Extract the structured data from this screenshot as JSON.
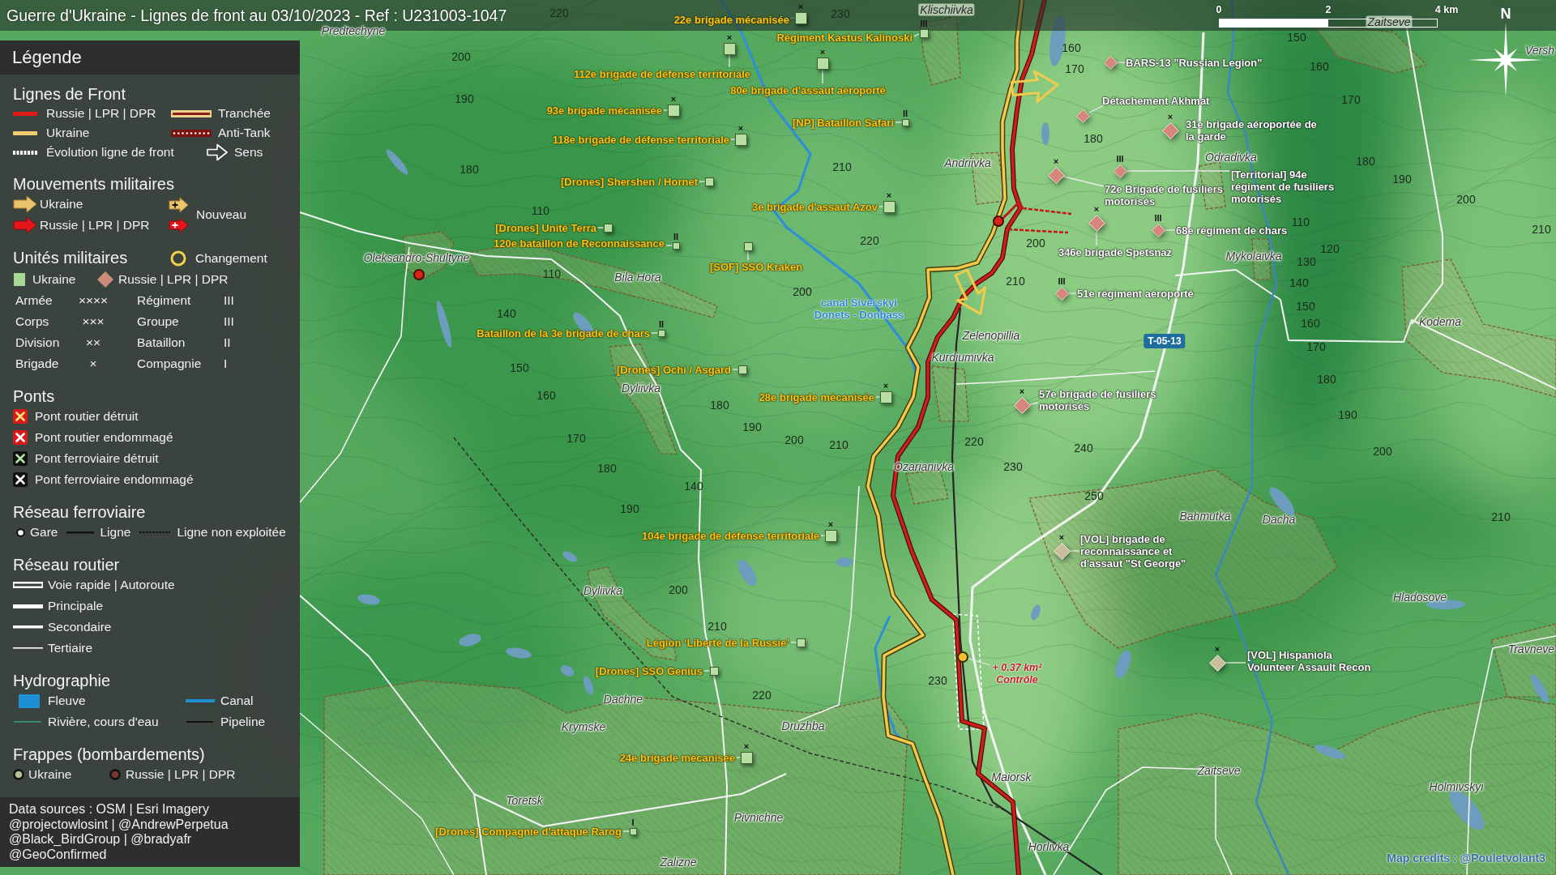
{
  "title_bar": {
    "title": "Guerre d'Ukraine - Lignes de front au 03/10/2023 - Ref : U231003-1047"
  },
  "scale_bar": {
    "ticks": [
      "0",
      "2",
      "4 km"
    ]
  },
  "compass": {
    "label": "N"
  },
  "legend": {
    "title": "Légende",
    "sections": [
      {
        "kind": "front-lines",
        "title": "Lignes de Front",
        "items": [
          {
            "kind": "russia-line",
            "label": "Russie | LPR | DPR"
          },
          {
            "kind": "trench",
            "label": "Tranchée"
          },
          {
            "kind": "ukraine-line",
            "label": "Ukraine"
          },
          {
            "kind": "anti-tank",
            "label": "Anti-Tank"
          },
          {
            "kind": "evolution",
            "label": "Évolution ligne de front"
          },
          {
            "kind": "direction",
            "label": "Sens"
          }
        ]
      },
      {
        "kind": "movements",
        "title": "Mouvements militaires",
        "items": [
          {
            "kind": "ukraine-arrow",
            "label": "Ukraine"
          },
          {
            "kind": "new-arrows",
            "label": "Nouveau"
          },
          {
            "kind": "russia-arrow",
            "label": "Russie | LPR | DPR"
          }
        ]
      },
      {
        "kind": "units",
        "title": "Unités militaires",
        "aside": {
          "kind": "change-ring",
          "label": "Changement"
        },
        "items": [
          {
            "kind": "ukraine-unit",
            "label": "Ukraine"
          },
          {
            "kind": "russia-unit",
            "label": "Russie | LPR | DPR"
          }
        ],
        "echelons": [
          {
            "label": "Armée",
            "symbol": "××××"
          },
          {
            "label": "Régiment",
            "symbol": "III"
          },
          {
            "label": "Corps",
            "symbol": "×××"
          },
          {
            "label": "Groupe",
            "symbol": "III"
          },
          {
            "label": "Division",
            "symbol": "××"
          },
          {
            "label": "Bataillon",
            "symbol": "II"
          },
          {
            "label": "Brigade",
            "symbol": "×"
          },
          {
            "label": "Compagnie",
            "symbol": "I"
          }
        ]
      },
      {
        "kind": "bridges",
        "title": "Ponts",
        "items": [
          {
            "kind": "road-destroyed",
            "label": "Pont routier détruit"
          },
          {
            "kind": "road-damaged",
            "label": "Pont routier endommagé"
          },
          {
            "kind": "rail-destroyed",
            "label": "Pont ferroviaire détruit"
          },
          {
            "kind": "rail-damaged",
            "label": "Pont ferroviaire endommagé"
          }
        ]
      },
      {
        "kind": "railway",
        "title": "Réseau ferroviaire",
        "items": [
          {
            "kind": "station",
            "label": "Gare"
          },
          {
            "kind": "rail-line",
            "label": "Ligne"
          },
          {
            "kind": "rail-disused",
            "label": "Ligne non exploitée"
          }
        ]
      },
      {
        "kind": "roads",
        "title": "Réseau routier",
        "items": [
          {
            "kind": "expressway",
            "label": "Voie rapide | Autoroute"
          },
          {
            "kind": "primary",
            "label": "Principale"
          },
          {
            "kind": "secondary",
            "label": "Secondaire"
          },
          {
            "kind": "tertiary",
            "label": "Tertiaire"
          }
        ]
      },
      {
        "kind": "hydro",
        "title": "Hydrographie",
        "items": [
          {
            "kind": "river-area",
            "label": "Fleuve"
          },
          {
            "kind": "canal",
            "label": "Canal"
          },
          {
            "kind": "stream",
            "label": "Rivière, cours d'eau"
          },
          {
            "kind": "pipeline",
            "label": "Pipeline"
          }
        ]
      },
      {
        "kind": "strikes",
        "title": "Frappes (bombardements)",
        "items": [
          {
            "kind": "ukraine-strike",
            "label": "Ukraine"
          },
          {
            "kind": "russia-strike",
            "label": "Russie | LPR | DPR"
          }
        ]
      }
    ],
    "sources": [
      "Data sources : OSM | Esri Imagery",
      "@projectowlosint | @AndrewPerpetua",
      "@Black_BirdGroup | @bradyafr",
      "@GeoConfirmed"
    ]
  },
  "map": {
    "places": [
      "Predtechyne",
      "Klischiivka",
      "Zaitseve",
      "Versh",
      "Andriivka",
      "Odradivka",
      "Oleksandro-Shultyne",
      "Mykolaivka",
      "Bila Hora",
      "Kodema",
      "Zelenopillia",
      "Kurdiumivka",
      "Dyliivka",
      "Ozarianivka",
      "Bahmutka",
      "Dacha",
      "Dyliivka",
      "Hladosove",
      "Travneve",
      "Dachne",
      "Druzhba",
      "Krymske",
      "Zaitseve",
      "Maiorsk",
      "Holmivskyi",
      "Toretsk",
      "Pivnichne",
      "Horlivka",
      "Zalizne"
    ],
    "elevations": [
      "220",
      "230",
      "150",
      "160",
      "200",
      "160",
      "170",
      "190",
      "170",
      "180",
      "180",
      "210",
      "180",
      "190",
      "200",
      "110",
      "110",
      "210",
      "220",
      "200",
      "120",
      "130",
      "110",
      "210",
      "140",
      "200",
      "150",
      "140",
      "160",
      "170",
      "150",
      "180",
      "160",
      "180",
      "190",
      "190",
      "170",
      "200",
      "220",
      "210",
      "240",
      "200",
      "230",
      "180",
      "140",
      "250",
      "190",
      "210",
      "200",
      "210",
      "230",
      "220"
    ],
    "canal_label": "canal Siverskyi Donets - Donbass",
    "road_number": "T-05-13",
    "units": [
      {
        "name": "22e brigade mécanisée",
        "echelon": "×",
        "kind": "ukraine"
      },
      {
        "name": "Régiment Kastus Kalinoski",
        "echelon": "III",
        "kind": "ukraine"
      },
      {
        "name": "112e brigade de défense territoriale",
        "echelon": "×",
        "kind": "ukraine"
      },
      {
        "name": "80e brigade d'assaut aéroporté",
        "echelon": "×",
        "kind": "ukraine"
      },
      {
        "name": "93e brigade mécanisée",
        "echelon": "×",
        "kind": "ukraine"
      },
      {
        "name": "[NP] Bataillon Safari",
        "echelon": "II",
        "kind": "ukraine"
      },
      {
        "name": "118e brigade de défense territoriale",
        "echelon": "×",
        "kind": "ukraine"
      },
      {
        "name": "[Drones] Shershen / Hornet",
        "kind": "ukraine"
      },
      {
        "name": "3e brigade d'assaut Azov",
        "echelon": "×",
        "kind": "ukraine"
      },
      {
        "name": "[Drones] Unité Terra",
        "kind": "ukraine"
      },
      {
        "name": "120e bataillon de Reconnaissance",
        "echelon": "II",
        "kind": "ukraine"
      },
      {
        "name": "[SOF] SSO Kraken",
        "kind": "ukraine"
      },
      {
        "name": "Bataillon de la 3e brigade de chars",
        "echelon": "II",
        "kind": "ukraine"
      },
      {
        "name": "[Drones] Ochi / Asgard",
        "kind": "ukraine"
      },
      {
        "name": "28e brigade mécanisée",
        "echelon": "×",
        "kind": "ukraine"
      },
      {
        "name": "104e brigade de défense territoriale",
        "echelon": "×",
        "kind": "ukraine"
      },
      {
        "name": "Légion ‘Liberté de la Russie’",
        "kind": "ukraine"
      },
      {
        "name": "[Drones] SSO Genius",
        "kind": "ukraine"
      },
      {
        "name": "24e brigade mécanisée",
        "echelon": "×",
        "kind": "ukraine"
      },
      {
        "name": "[Drones] Compagnie d'attaque Rarog",
        "echelon": "I",
        "kind": "ukraine"
      },
      {
        "name": "BARS-13 \"Russian Legion\"",
        "kind": "russia"
      },
      {
        "name": "Détachement Akhmat",
        "kind": "russia"
      },
      {
        "name": "31e brigade aéroportée de la garde",
        "echelon": "×",
        "kind": "russia"
      },
      {
        "name": "72e Brigade de fusiliers motorisés",
        "echelon": "×",
        "kind": "russia"
      },
      {
        "name": "[Territorial] 94e régiment de fusiliers motorisés",
        "echelon": "III",
        "kind": "russia"
      },
      {
        "name": "346e brigade Spetsnaz",
        "echelon": "×",
        "kind": "russia"
      },
      {
        "name": "68e régiment de chars",
        "echelon": "III",
        "kind": "russia"
      },
      {
        "name": "51e régiment aéroporté",
        "echelon": "III",
        "kind": "russia"
      },
      {
        "name": "57e brigade de fusiliers motorisés",
        "echelon": "×",
        "kind": "russia"
      },
      {
        "name": "[VOL] brigade de reconnaissance et d'assaut \"St George\"",
        "echelon": "×",
        "kind": "volunteer"
      },
      {
        "name": "[VOL] Hispaniola Volunteer Assault Recon",
        "echelon": "×",
        "kind": "volunteer"
      }
    ],
    "strikes": [
      {
        "kind": "russia"
      },
      {
        "kind": "russia"
      },
      {
        "kind": "ukraine"
      }
    ],
    "area_change": {
      "value": "+ 0.37 km²",
      "label": "Contrôle"
    },
    "credits": "Map credits : @Pouletvolant3"
  }
}
